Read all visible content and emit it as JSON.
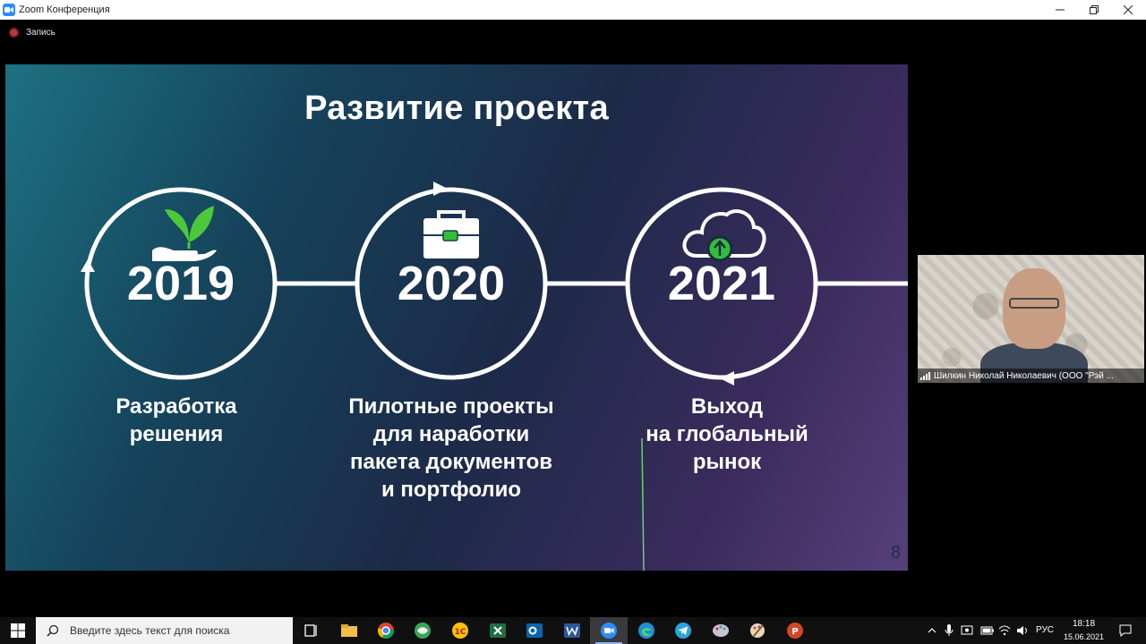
{
  "window": {
    "title": "Zoom Конференция"
  },
  "recording": {
    "label": "Запись"
  },
  "slide": {
    "title": "Развитие проекта",
    "page_number": "8",
    "milestones": [
      {
        "year": "2019",
        "icon": "seedling-hand-icon",
        "lines": [
          "Разработка",
          "решения"
        ]
      },
      {
        "year": "2020",
        "icon": "briefcase-icon",
        "lines": [
          "Пилотные проекты",
          "для наработки",
          "пакета документов",
          "и портфолио"
        ]
      },
      {
        "year": "2021",
        "icon": "cloud-upload-icon",
        "lines": [
          "Выход",
          "на глобальный",
          "рынок"
        ]
      }
    ],
    "colors": {
      "leaf": "#4cc83a",
      "accent_green": "#2fbf3a"
    }
  },
  "video": {
    "participant_name": "Шилкин Николай Николаевич (ООО \"Рэй ..."
  },
  "taskbar": {
    "search_placeholder": "Введите здесь текст для поиска",
    "language": "РУС",
    "time": "18:18",
    "date": "15.06.2021"
  }
}
